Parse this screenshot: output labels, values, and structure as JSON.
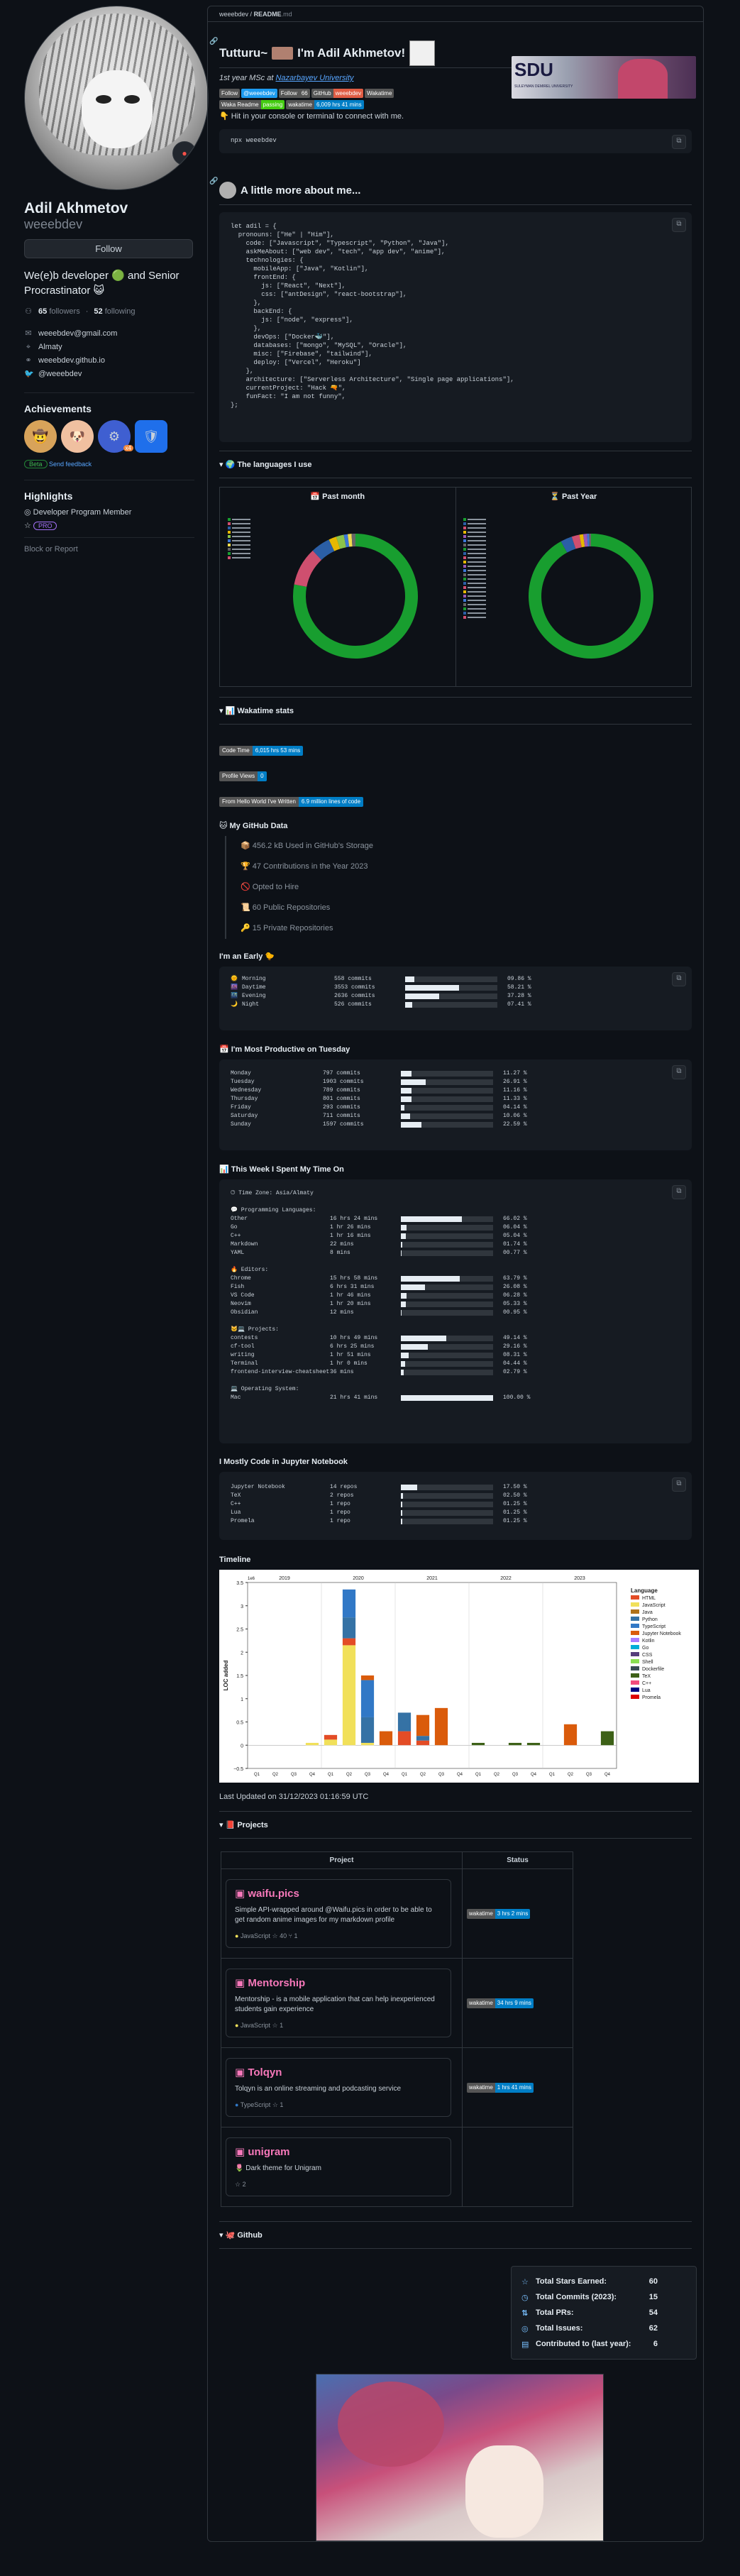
{
  "sidebar": {
    "name": "Adil Akhmetov",
    "login": "weeebdev",
    "follow": "Follow",
    "bio_a": "We(e)b developer ",
    "bio_b": " and Senior Procrastinator ",
    "bio_emoji_a": "🟢",
    "bio_emoji_b": "😺",
    "followers": "65",
    "followers_label": "followers",
    "following": "52",
    "following_label": "following",
    "email": "weeebdev@gmail.com",
    "location": "Almaty",
    "website": "weeebdev.github.io",
    "twitter": "@weeebdev",
    "achievements_title": "Achievements",
    "beta": "Beta",
    "send_feedback": "Send feedback",
    "ach_count": "x4",
    "highlights_title": "Highlights",
    "highlight1": "Developer Program Member",
    "pro": "PRO",
    "block": "Block or Report"
  },
  "crumb": {
    "user": "weeebdev",
    "file": "README",
    "ext": ".md"
  },
  "intro": {
    "title": "Tutturu~",
    "title_b": " I'm Adil Akhmetov!",
    "msc": "1st year MSc at",
    "university": "Nazarbayev University",
    "badges": [
      {
        "l": "Follow",
        "r": "",
        "c": "#555"
      },
      {
        "l": "@weeebdev",
        "r": "",
        "c": "#1d9bf0"
      },
      {
        "l": "Follow",
        "r": "66",
        "c": "#555"
      },
      {
        "l": "GitHub",
        "r": "weeebdev",
        "c": "#e05d44"
      },
      {
        "l": "Wakatime",
        "r": "",
        "c": "#555"
      },
      {
        "l": "Waka Readme",
        "r": "passing",
        "c": "#4c1"
      },
      {
        "l": "wakatime",
        "r": "6,009 hrs 41 mins",
        "c": "#007ec6"
      }
    ],
    "hit": "Hit in your console or terminal to connect with me.",
    "npx": "npx weeebdev",
    "sdu": "SDU",
    "sdu_sub": "SULEYMAN DEMIREL UNIVERSITY"
  },
  "about": {
    "title": "A little more about me...",
    "code": "let adil = {\n  pronouns: [\"He\" | \"Him\"],\n    code: [\"Javascript\", \"Typescript\", \"Python\", \"Java\"],\n    askMeAbout: [\"web dev\", \"tech\", \"app dev\", \"anime\"],\n    technologies: {\n      mobileApp: [\"Java\", \"Kotlin\"],\n      frontEnd: {\n        js: [\"React\", \"Next\"],\n        css: [\"antDesign\", \"react-bootstrap\"],\n      },\n      backEnd: {\n        js: [\"node\", \"express\"],\n      },\n      devOps: [\"Docker🐳\"],\n      databases: [\"mongo\", \"MySQL\", \"Oracle\"],\n      misc: [\"Firebase\", \"tailwind\"],\n      deploy: [\"Vercel\", \"Heroku\"]\n    },\n    architecture: [\"Serverless Architecture\", \"Single page applications\"],\n    currentProject: \"Hack 🔫\",\n    funFact: \"I am not funny\",\n};"
  },
  "languages": {
    "title": "🌍 The languages I use",
    "past_month": "Past month",
    "past_year": "Past Year",
    "month_colors": [
      "#189e2f",
      "#cf4f6f",
      "#2b5fa6",
      "#e6b800",
      "#8bc34a",
      "#3c78d8",
      "#f0db4f",
      "#666"
    ],
    "month_values": [
      78,
      10,
      5,
      2,
      2,
      1,
      1,
      1
    ],
    "year_colors": [
      "#189e2f",
      "#2b5fa6",
      "#cf4f6f",
      "#e6b800",
      "#9b59b6",
      "#3c78d8",
      "#666"
    ],
    "year_values": [
      92,
      3,
      2,
      1,
      1,
      0.5,
      0.5
    ]
  },
  "waka": {
    "title": "Wakatime stats",
    "code_time_l": "Code Time",
    "code_time_r": "6,015 hrs 53 mins",
    "pv_l": "Profile Views",
    "pv_r": "0",
    "hw_l": "From Hello World I've Written",
    "hw_r": "6.9 million lines of code"
  },
  "gh": {
    "title": "🐱 My GitHub Data",
    "items": [
      "📦 456.2 kB Used in GitHub's Storage",
      "🏆 47 Contributions in the Year 2023",
      "🚫 Opted to Hire",
      "📜 60 Public Repositories",
      "🔑 15 Private Repositories"
    ]
  },
  "early": {
    "title": "I'm an Early 🐤",
    "rows": [
      {
        "e": "🌞",
        "n": "Morning",
        "c": "558 commits",
        "p": 9.86,
        "t": "09.86 %"
      },
      {
        "e": "🌆",
        "n": "Daytime",
        "c": "3553 commits",
        "p": 58.21,
        "t": "58.21 %"
      },
      {
        "e": "🌃",
        "n": "Evening",
        "c": "2636 commits",
        "p": 37.28,
        "t": "37.28 %"
      },
      {
        "e": "🌙",
        "n": "Night",
        "c": "526 commits",
        "p": 7.41,
        "t": "07.41 %"
      }
    ]
  },
  "prod": {
    "title": "📅 I'm Most Productive on Tuesday",
    "rows": [
      {
        "n": "Monday",
        "c": "797 commits",
        "p": 11.27,
        "t": "11.27 %"
      },
      {
        "n": "Tuesday",
        "c": "1903 commits",
        "p": 26.91,
        "t": "26.91 %"
      },
      {
        "n": "Wednesday",
        "c": "789 commits",
        "p": 11.16,
        "t": "11.16 %"
      },
      {
        "n": "Thursday",
        "c": "801 commits",
        "p": 11.33,
        "t": "11.33 %"
      },
      {
        "n": "Friday",
        "c": "293 commits",
        "p": 4.14,
        "t": "04.14 %"
      },
      {
        "n": "Saturday",
        "c": "711 commits",
        "p": 10.06,
        "t": "10.06 %"
      },
      {
        "n": "Sunday",
        "c": "1597 commits",
        "p": 22.59,
        "t": "22.59 %"
      }
    ]
  },
  "week": {
    "title": "📊 This Week I Spent My Time On",
    "tz": "🕑︎ Time Zone: Asia/Almaty",
    "groups": [
      {
        "h": "💬 Programming Languages:",
        "rows": [
          {
            "n": "Other",
            "v": "16 hrs 24 mins",
            "p": 66.02,
            "t": "66.02 %"
          },
          {
            "n": "Go",
            "v": "1 hr 26 mins",
            "p": 6.04,
            "t": "06.04 %"
          },
          {
            "n": "C++",
            "v": "1 hr 16 mins",
            "p": 5.04,
            "t": "05.04 %"
          },
          {
            "n": "Markdown",
            "v": "22 mins",
            "p": 1.74,
            "t": "01.74 %"
          },
          {
            "n": "YAML",
            "v": "8 mins",
            "p": 0.77,
            "t": "00.77 %"
          }
        ]
      },
      {
        "h": "🔥 Editors:",
        "rows": [
          {
            "n": "Chrome",
            "v": "15 hrs 58 mins",
            "p": 63.79,
            "t": "63.79 %"
          },
          {
            "n": "Fish",
            "v": "6 hrs 31 mins",
            "p": 26.08,
            "t": "26.08 %"
          },
          {
            "n": "VS Code",
            "v": "1 hr 46 mins",
            "p": 6.28,
            "t": "06.28 %"
          },
          {
            "n": "Neovim",
            "v": "1 hr 20 mins",
            "p": 5.33,
            "t": "05.33 %"
          },
          {
            "n": "Obsidian",
            "v": "12 mins",
            "p": 0.95,
            "t": "00.95 %"
          }
        ]
      },
      {
        "h": "🐱‍💻 Projects:",
        "rows": [
          {
            "n": "contests",
            "v": "10 hrs 49 mins",
            "p": 49.14,
            "t": "49.14 %"
          },
          {
            "n": "cf-tool",
            "v": "6 hrs 25 mins",
            "p": 29.16,
            "t": "29.16 %"
          },
          {
            "n": "writing",
            "v": "1 hr 51 mins",
            "p": 8.31,
            "t": "08.31 %"
          },
          {
            "n": "Terminal",
            "v": "1 hr 0 mins",
            "p": 4.44,
            "t": "04.44 %"
          },
          {
            "n": "frontend-interview-cheatsheet",
            "v": "36 mins",
            "p": 2.79,
            "t": "02.79 %"
          }
        ]
      },
      {
        "h": "💻 Operating System:",
        "rows": [
          {
            "n": "Mac",
            "v": "21 hrs 41 mins",
            "p": 100,
            "t": "100.00 %"
          }
        ]
      }
    ]
  },
  "jup": {
    "title": "I Mostly Code in Jupyter Notebook",
    "rows": [
      {
        "n": "Jupyter Notebook",
        "v": "14 repos",
        "p": 17.5,
        "t": "17.50 %"
      },
      {
        "n": "TeX",
        "v": "2 repos",
        "p": 2.5,
        "t": "02.50 %"
      },
      {
        "n": "C++",
        "v": "1 repo",
        "p": 1.25,
        "t": "01.25 %"
      },
      {
        "n": "Lua",
        "v": "1 repo",
        "p": 1.25,
        "t": "01.25 %"
      },
      {
        "n": "Promela",
        "v": "1 repo",
        "p": 1.25,
        "t": "01.25 %"
      }
    ]
  },
  "timeline": {
    "title": "Timeline",
    "ylabel": "LOC added",
    "legend_title": "Language",
    "years": [
      "2019",
      "2020",
      "2021",
      "2022",
      "2023"
    ],
    "quarters": [
      "Q1",
      "Q2",
      "Q3",
      "Q4",
      "Q1",
      "Q2",
      "Q3",
      "Q4",
      "Q1",
      "Q2",
      "Q3",
      "Q4",
      "Q1",
      "Q2",
      "Q3",
      "Q4",
      "Q1",
      "Q2",
      "Q3",
      "Q4"
    ],
    "yticks": [
      "−0.5",
      "0",
      "0.5",
      "1",
      "1.5",
      "2",
      "2.5",
      "3",
      "3.5"
    ],
    "ymult": "1e6",
    "legend": [
      {
        "n": "HTML",
        "c": "#e34c26"
      },
      {
        "n": "JavaScript",
        "c": "#f1e05a"
      },
      {
        "n": "Java",
        "c": "#b07219"
      },
      {
        "n": "Python",
        "c": "#3572a5"
      },
      {
        "n": "TypeScript",
        "c": "#3178c6"
      },
      {
        "n": "Jupyter Notebook",
        "c": "#da5b0b"
      },
      {
        "n": "Kotlin",
        "c": "#a97bff"
      },
      {
        "n": "Go",
        "c": "#00add8"
      },
      {
        "n": "CSS",
        "c": "#563d7c"
      },
      {
        "n": "Shell",
        "c": "#89e051"
      },
      {
        "n": "Dockerfile",
        "c": "#384d54"
      },
      {
        "n": "TeX",
        "c": "#3d6117"
      },
      {
        "n": "C++",
        "c": "#f34b7d"
      },
      {
        "n": "Lua",
        "c": "#000080"
      },
      {
        "n": "Promela",
        "c": "#de0000"
      }
    ]
  },
  "chart_data": {
    "type": "bar",
    "title": "",
    "xlabel": "",
    "ylabel": "LOC added",
    "ylim": [
      -0.5,
      3.5
    ],
    "y_multiplier": "1e6",
    "categories": [
      "2019 Q1",
      "2019 Q2",
      "2019 Q3",
      "2019 Q4",
      "2020 Q1",
      "2020 Q2",
      "2020 Q3",
      "2020 Q4",
      "2021 Q1",
      "2021 Q2",
      "2021 Q3",
      "2021 Q4",
      "2022 Q1",
      "2022 Q2",
      "2022 Q3",
      "2022 Q4",
      "2023 Q1",
      "2023 Q2",
      "2023 Q3",
      "2023 Q4"
    ],
    "series": [
      {
        "name": "JavaScript",
        "values": [
          0,
          0,
          0,
          0.05,
          0.12,
          2.15,
          0.05,
          0,
          0,
          0,
          0,
          0,
          0,
          0,
          0,
          0,
          0,
          0,
          0,
          0
        ]
      },
      {
        "name": "HTML",
        "values": [
          0,
          0,
          0,
          0,
          0.1,
          0.15,
          0,
          0,
          0.3,
          0.1,
          0,
          0,
          0,
          0,
          0,
          0,
          0,
          0,
          0,
          0
        ]
      },
      {
        "name": "Python",
        "values": [
          0,
          0,
          0,
          0,
          0,
          0.45,
          0.55,
          0,
          0.4,
          0.1,
          0,
          0,
          0,
          0,
          0,
          0,
          0,
          0,
          0,
          0
        ]
      },
      {
        "name": "TypeScript",
        "values": [
          0,
          0,
          0,
          0,
          0,
          0.6,
          0.8,
          0,
          0,
          0,
          0,
          0,
          0,
          0,
          0,
          0,
          0,
          0,
          0,
          0
        ]
      },
      {
        "name": "Jupyter Notebook",
        "values": [
          0,
          0,
          0,
          0,
          0,
          0,
          0.1,
          0.3,
          0,
          0.45,
          0.8,
          0,
          0,
          0,
          0,
          0,
          0,
          0.45,
          0,
          0
        ]
      },
      {
        "name": "TeX",
        "values": [
          0,
          0,
          0,
          0,
          0,
          0,
          0,
          0,
          0,
          0,
          0,
          0,
          0.05,
          0,
          0.05,
          0.05,
          0,
          0,
          0,
          0.3
        ]
      }
    ]
  },
  "last_updated": "Last Updated on 31/12/2023 01:16:59 UTC",
  "projects": {
    "title": "📕 Projects",
    "h_project": "Project",
    "h_status": "Status",
    "items": [
      {
        "name": "waifu.pics",
        "desc": "Simple API-wrapped around @Waifu.pics in order to be able to get random anime images for my markdown profile",
        "lang": "JavaScript",
        "lc": "#f1e05a",
        "stars": "40",
        "forks": "1",
        "waka": "wakatime",
        "time": "3 hrs 2 mins"
      },
      {
        "name": "Mentorship",
        "desc": "Mentorship - is a mobile application that can help inexperienced students gain experience",
        "lang": "JavaScript",
        "lc": "#f1e05a",
        "stars": "1",
        "forks": "",
        "waka": "wakatime",
        "time": "34 hrs 9 mins"
      },
      {
        "name": "Tolqyn",
        "desc": "Tolqyn is an online streaming and podcasting service",
        "lang": "TypeScript",
        "lc": "#3178c6",
        "stars": "1",
        "forks": "",
        "waka": "wakatime",
        "time": "1 hrs 41 mins"
      },
      {
        "name": "unigram",
        "desc": "🌷 Dark theme for Unigram",
        "lang": "",
        "lc": "",
        "stars": "2",
        "forks": "",
        "waka": "",
        "time": ""
      }
    ]
  },
  "github": {
    "title": "🐙 Github",
    "stats": [
      {
        "n": "Total Stars Earned:",
        "v": "60",
        "i": "☆"
      },
      {
        "n": "Total Commits (2023):",
        "v": "15",
        "i": "◷"
      },
      {
        "n": "Total PRs:",
        "v": "54",
        "i": "⇅"
      },
      {
        "n": "Total Issues:",
        "v": "62",
        "i": "◎"
      },
      {
        "n": "Contributed to (last year):",
        "v": "6",
        "i": "▤"
      }
    ]
  }
}
